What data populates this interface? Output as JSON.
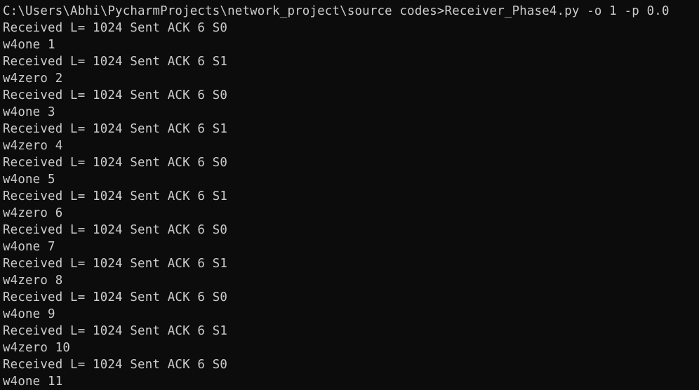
{
  "terminal": {
    "lines": [
      "C:\\Users\\Abhi\\PycharmProjects\\network_project\\source codes>Receiver_Phase4.py -o 1 -p 0.0",
      "Received L= 1024 Sent ACK 6 S0",
      "w4one 1",
      "Received L= 1024 Sent ACK 6 S1",
      "w4zero 2",
      "Received L= 1024 Sent ACK 6 S0",
      "w4one 3",
      "Received L= 1024 Sent ACK 6 S1",
      "w4zero 4",
      "Received L= 1024 Sent ACK 6 S0",
      "w4one 5",
      "Received L= 1024 Sent ACK 6 S1",
      "w4zero 6",
      "Received L= 1024 Sent ACK 6 S0",
      "w4one 7",
      "Received L= 1024 Sent ACK 6 S1",
      "w4zero 8",
      "Received L= 1024 Sent ACK 6 S0",
      "w4one 9",
      "Received L= 1024 Sent ACK 6 S1",
      "w4zero 10",
      "Received L= 1024 Sent ACK 6 S0",
      "w4one 11"
    ],
    "colors": {
      "background": "#0c0c0c",
      "text": "#cccccc"
    }
  }
}
